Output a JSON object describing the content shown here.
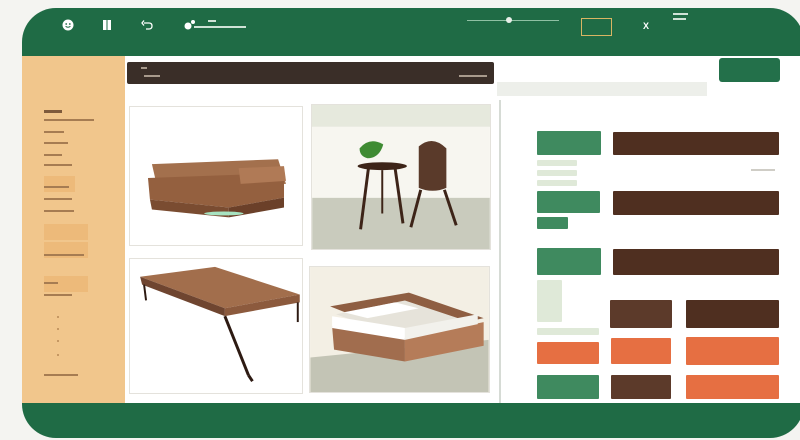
{
  "toolbar": {
    "icons": [
      "smiley-icon",
      "book-icon",
      "undo-icon",
      "slider-icon",
      "close-icon"
    ],
    "close_glyph": "X"
  },
  "catalog": {
    "items": [
      {
        "name": "sofa",
        "color": "#9c6a48"
      },
      {
        "name": "side-table-and-chair",
        "color": "#4a2f22"
      },
      {
        "name": "bench",
        "color": "#9a6748"
      },
      {
        "name": "bed",
        "color": "#a26b4e"
      }
    ]
  },
  "colors": {
    "frame": "#1f6b45",
    "sidebar": "#f1c68c",
    "green": "#3f8a5f",
    "brown": "#4f2f20",
    "orange": "#e66f42"
  }
}
